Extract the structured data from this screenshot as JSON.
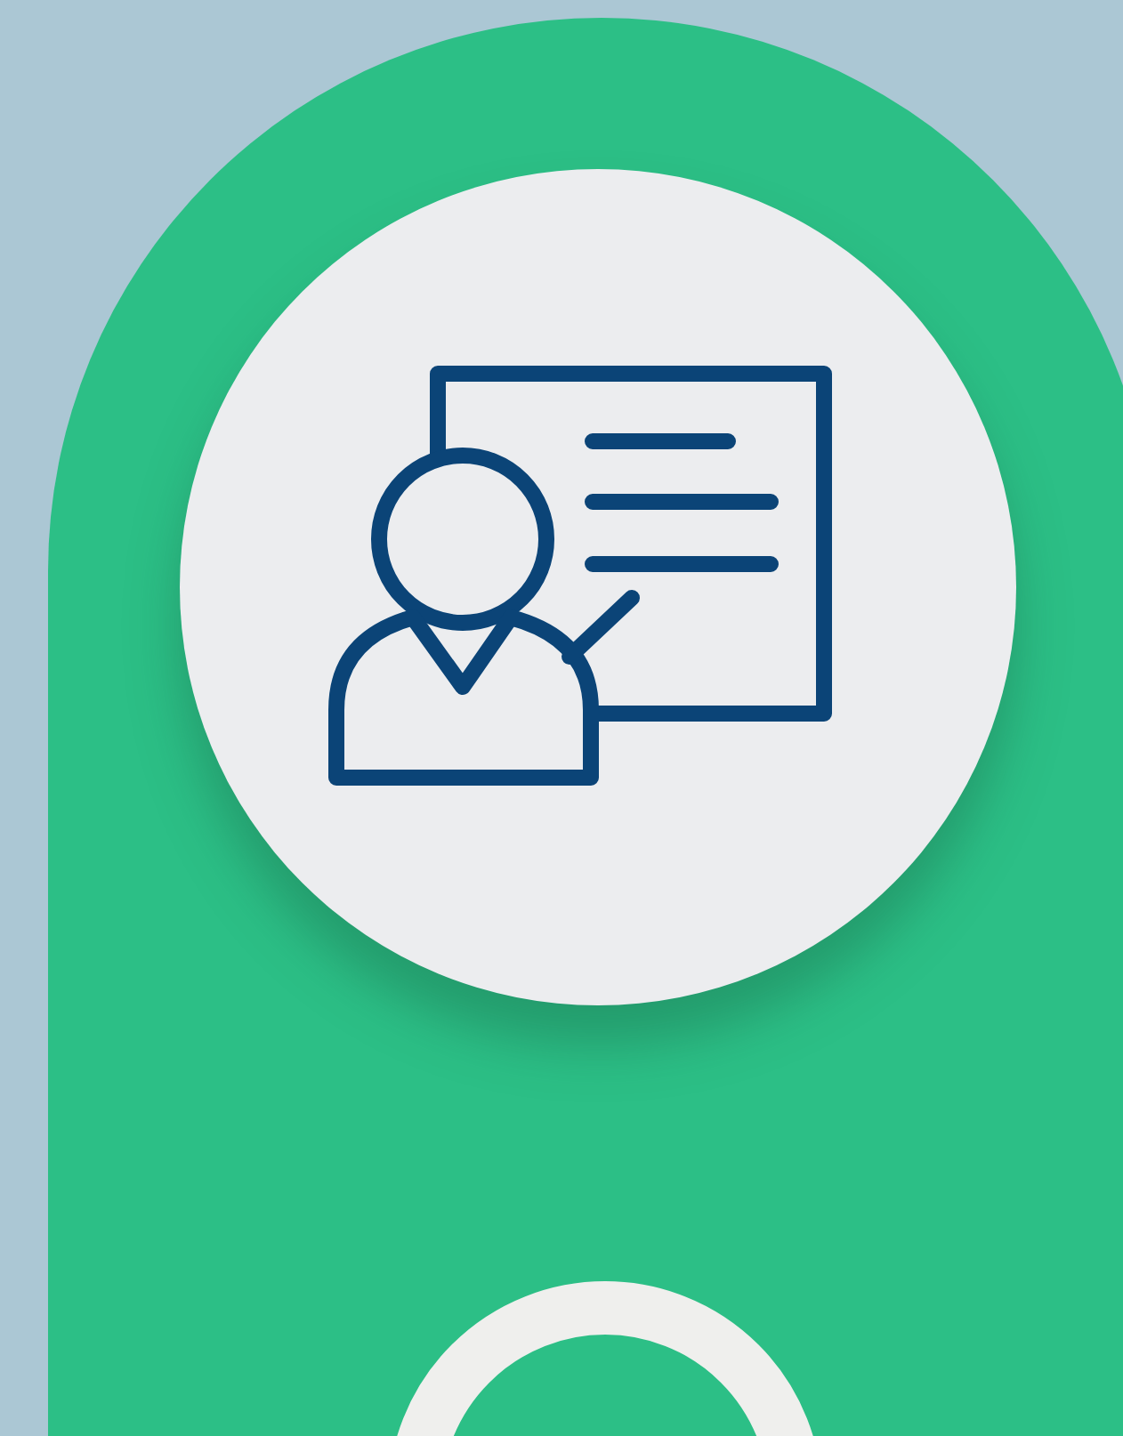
{
  "panel": {
    "badges": [
      {
        "kind": "presenter"
      },
      {
        "kind": "ring"
      }
    ]
  }
}
